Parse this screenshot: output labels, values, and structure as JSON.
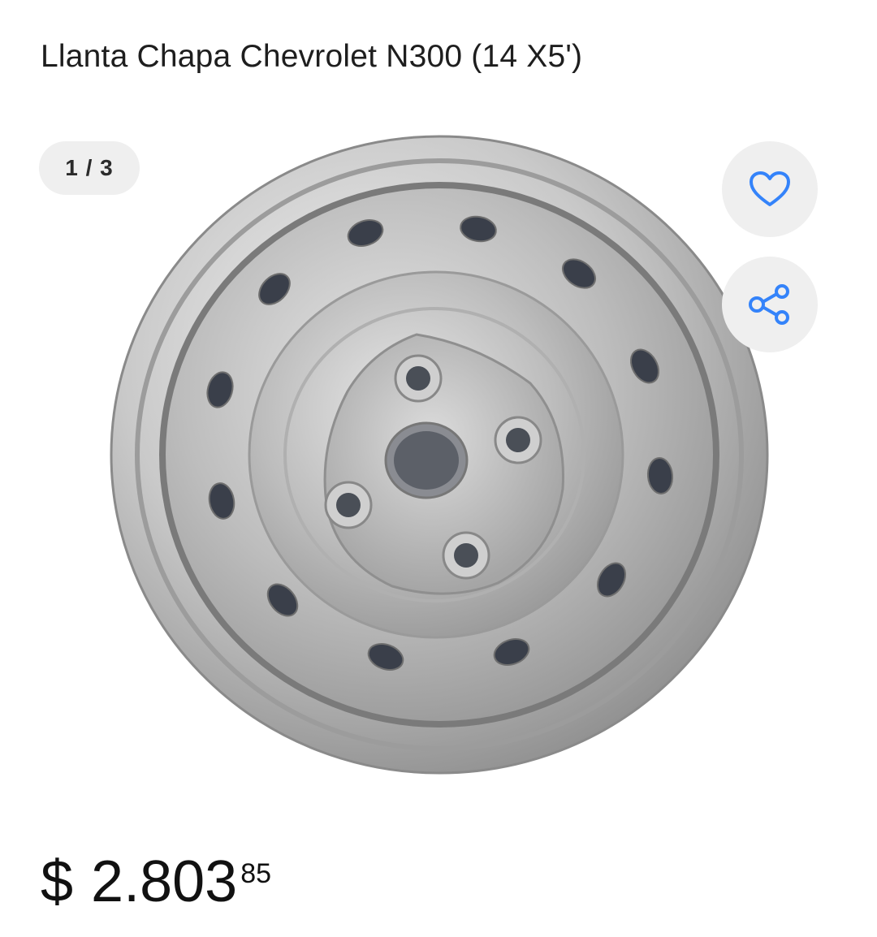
{
  "product": {
    "title": "Llanta Chapa Chevrolet N300 (14 X5')"
  },
  "gallery": {
    "counter": "1 / 3",
    "image_alt": "steel wheel rim"
  },
  "actions": {
    "favorite_icon": "heart-icon",
    "share_icon": "share-icon",
    "accent_color": "#3483fa"
  },
  "price": {
    "currency": "$",
    "amount": "2.803",
    "cents": "85"
  }
}
